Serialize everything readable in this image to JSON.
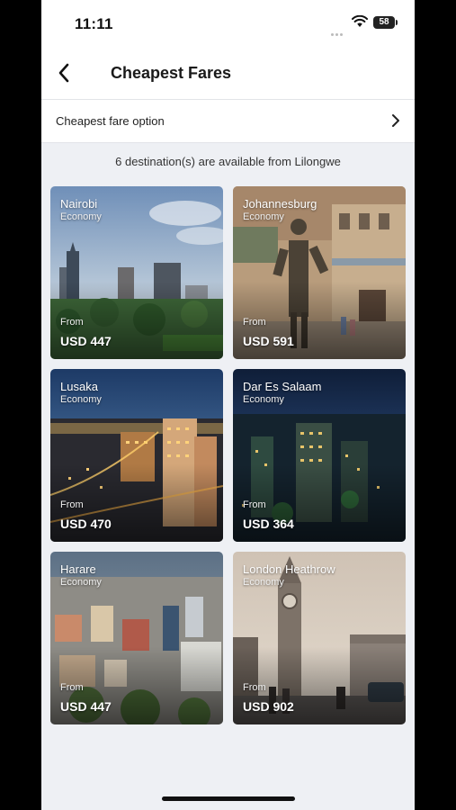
{
  "status": {
    "time": "11:11",
    "battery": "58"
  },
  "nav": {
    "title": "Cheapest Fares"
  },
  "option": {
    "label": "Cheapest fare option"
  },
  "availability": "6 destination(s) are available from Lilongwe",
  "destinations": [
    {
      "city": "Nairobi",
      "cabin": "Economy",
      "from": "From",
      "price": "USD 447"
    },
    {
      "city": "Johannesburg",
      "cabin": "Economy",
      "from": "From",
      "price": "USD 591"
    },
    {
      "city": "Lusaka",
      "cabin": "Economy",
      "from": "From",
      "price": "USD 470"
    },
    {
      "city": "Dar Es Salaam",
      "cabin": "Economy",
      "from": "From",
      "price": "USD 364"
    },
    {
      "city": "Harare",
      "cabin": "Economy",
      "from": "From",
      "price": "USD 447"
    },
    {
      "city": "London Heathrow",
      "cabin": "Economy",
      "from": "From",
      "price": "USD 902"
    }
  ]
}
